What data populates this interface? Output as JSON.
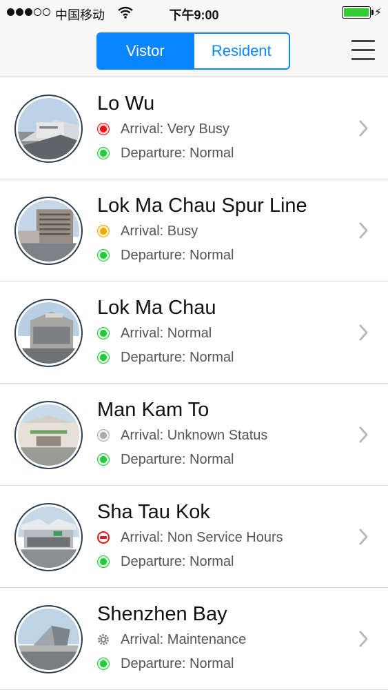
{
  "status_bar": {
    "carrier": "中国移动",
    "time": "下午9:00"
  },
  "segment": {
    "visitor_label": "Vistor",
    "resident_label": "Resident",
    "selected": "Vistor"
  },
  "colors": {
    "accent": "#0a84ff",
    "status_red": "#ee1111",
    "status_green": "#22c93a",
    "status_orange": "#f0a800",
    "status_gray": "#aaaaaa"
  },
  "checkpoints": [
    {
      "name": "Lo Wu",
      "arrival": "Arrival: Very Busy",
      "arrival_icon": "red-status-icon",
      "departure": "Departure: Normal",
      "departure_icon": "green-status-icon"
    },
    {
      "name": "Lok Ma Chau Spur Line",
      "arrival": "Arrival: Busy",
      "arrival_icon": "orange-status-icon",
      "departure": "Departure: Normal",
      "departure_icon": "green-status-icon"
    },
    {
      "name": "Lok Ma Chau",
      "arrival": "Arrival: Normal",
      "arrival_icon": "green-status-icon",
      "departure": "Departure: Normal",
      "departure_icon": "green-status-icon"
    },
    {
      "name": "Man Kam To",
      "arrival": "Arrival: Unknown Status",
      "arrival_icon": "gray-status-icon",
      "departure": "Departure: Normal",
      "departure_icon": "green-status-icon"
    },
    {
      "name": "Sha Tau Kok",
      "arrival": "Arrival: Non Service Hours",
      "arrival_icon": "no-service-icon",
      "departure": "Departure: Normal",
      "departure_icon": "green-status-icon"
    },
    {
      "name": "Shenzhen Bay",
      "arrival": "Arrival: Maintenance",
      "arrival_icon": "maintenance-gear-icon",
      "departure": "Departure: Normal",
      "departure_icon": "green-status-icon"
    }
  ]
}
